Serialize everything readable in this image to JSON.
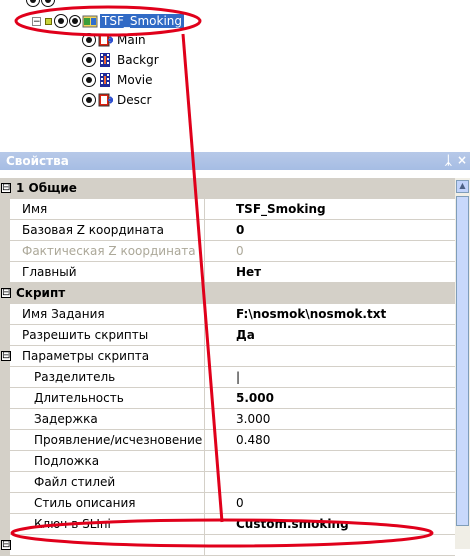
{
  "tree": {
    "root_label": "TSF_Smoking",
    "children": [
      {
        "label": "Main"
      },
      {
        "label": "Backgr"
      },
      {
        "label": "Movie"
      },
      {
        "label": "Descr"
      }
    ]
  },
  "panel": {
    "title": "Свойства",
    "pin_glyph": "ᛣ",
    "close_glyph": "×"
  },
  "grid": {
    "sections": [
      {
        "label": "1 Общие",
        "expander": "⊟"
      },
      {
        "label": "Скрипт",
        "expander": "⊟"
      },
      {
        "label": "Параметры скрипта",
        "expander": "⊟"
      }
    ],
    "rows": {
      "name": {
        "label": "Имя",
        "value": "TSF_Smoking"
      },
      "base_z": {
        "label": "Базовая Z координата",
        "value": "0"
      },
      "actual_z": {
        "label": "Фактическая Z координата",
        "value": "0"
      },
      "main": {
        "label": "Главный",
        "value": "Нет"
      },
      "task_name": {
        "label": "Имя Задания",
        "value": "F:\\nosmok\\nosmok.txt"
      },
      "allow_scripts": {
        "label": "Разрешить скрипты",
        "value": "Да"
      },
      "separator": {
        "label": "Разделитель",
        "value": "|"
      },
      "duration": {
        "label": "Длительность",
        "value": "5.000"
      },
      "delay": {
        "label": "Задержка",
        "value": "3.000"
      },
      "fade": {
        "label": "Проявление/исчезновение",
        "value": "0.480"
      },
      "substrate": {
        "label": "Подложка",
        "value": ""
      },
      "style_file": {
        "label": "Файл стилей",
        "value": ""
      },
      "desc_style": {
        "label": "Стиль описания",
        "value": "0"
      },
      "sl_key": {
        "label": "Ключ в SLIni",
        "value": "Custom.smoking"
      }
    },
    "bottom_row_expander": "⊟"
  },
  "colors": {
    "selection": "#316ac5",
    "panel_header": "#a6bde4",
    "annotation": "#e0001b",
    "category_bg": "#d4d0c8"
  }
}
